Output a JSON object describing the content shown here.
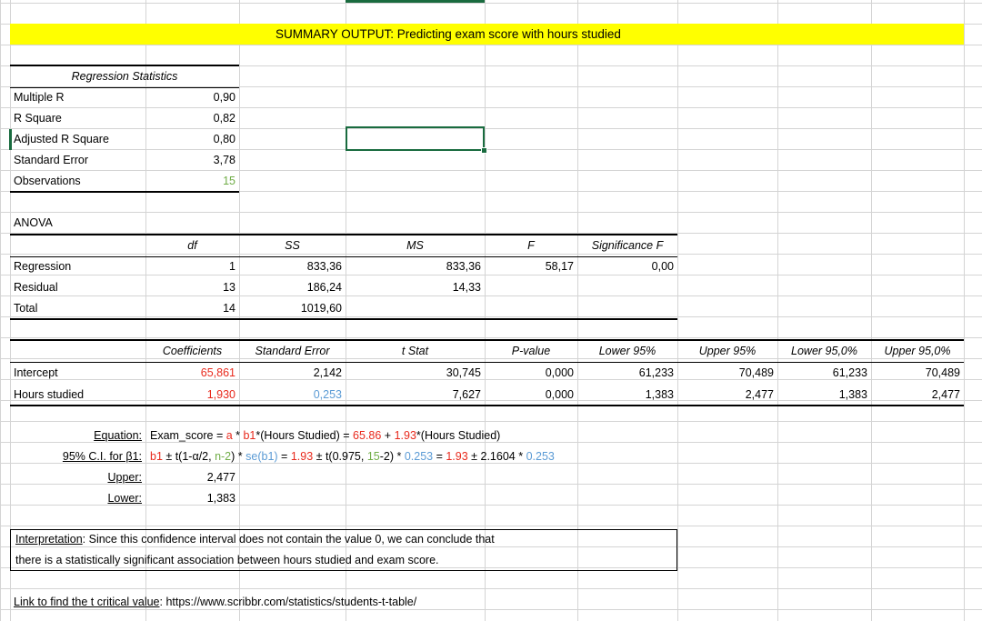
{
  "document": {
    "type": "spreadsheet",
    "title_banner": {
      "text": "SUMMARY OUTPUT: Predicting exam score with hours studied",
      "highlight_color": "#ffff00"
    }
  },
  "colors": {
    "accent_red": "#e8291c",
    "accent_green": "#70ad47",
    "accent_blue": "#5b9bd5",
    "selection_green": "#196b3f",
    "highlight_yellow": "#ffff00",
    "gridline": "#d4d4d4"
  },
  "regression_statistics": {
    "header": "Regression Statistics",
    "rows": [
      {
        "label": "Multiple R",
        "value": "0,90"
      },
      {
        "label": "R Square",
        "value": "0,82"
      },
      {
        "label": "Adjusted R Square",
        "value": "0,80"
      },
      {
        "label": "Standard Error",
        "value": "3,78"
      },
      {
        "label": "Observations",
        "value": "15"
      }
    ]
  },
  "anova": {
    "title": "ANOVA",
    "columns": [
      "",
      "df",
      "SS",
      "MS",
      "F",
      "Significance F"
    ],
    "rows": [
      {
        "label": "Regression",
        "df": "1",
        "ss": "833,36",
        "ms": "833,36",
        "f": "58,17",
        "sig_f": "0,00"
      },
      {
        "label": "Residual",
        "df": "13",
        "ss": "186,24",
        "ms": "14,33",
        "f": "",
        "sig_f": ""
      },
      {
        "label": "Total",
        "df": "14",
        "ss": "1019,60",
        "ms": "",
        "f": "",
        "sig_f": ""
      }
    ]
  },
  "coefficients": {
    "columns": [
      "",
      "Coefficients",
      "Standard Error",
      "t Stat",
      "P-value",
      "Lower 95%",
      "Upper 95%",
      "Lower 95,0%",
      "Upper 95,0%"
    ],
    "rows": [
      {
        "label": "Intercept",
        "coefficient": "65,861",
        "standard_error": "2,142",
        "t_stat": "30,745",
        "p_value": "0,000",
        "lower_95": "61,233",
        "upper_95": "70,489",
        "lower_95_0": "61,233",
        "upper_95_0": "70,489"
      },
      {
        "label": "Hours studied",
        "coefficient": "1,930",
        "standard_error": "0,253",
        "t_stat": "7,627",
        "p_value": "0,000",
        "lower_95": "1,383",
        "upper_95": "2,477",
        "lower_95_0": "1,383",
        "upper_95_0": "2,477"
      }
    ]
  },
  "equation": {
    "label": "Equation:",
    "parts": [
      {
        "text": "Exam_score = ",
        "color": "black"
      },
      {
        "text": "a",
        "color": "red"
      },
      {
        "text": " * ",
        "color": "black"
      },
      {
        "text": "b1",
        "color": "red"
      },
      {
        "text": "*(Hours Studied) = ",
        "color": "black"
      },
      {
        "text": "65.86",
        "color": "red"
      },
      {
        "text": " + ",
        "color": "black"
      },
      {
        "text": "1.93",
        "color": "red"
      },
      {
        "text": "*(Hours Studied)",
        "color": "black"
      }
    ]
  },
  "confidence_interval": {
    "label": "95% C.I. for β1:",
    "parts": [
      {
        "text": "b1",
        "color": "red"
      },
      {
        "text": " ± t(1-α/2, ",
        "color": "black"
      },
      {
        "text": "n-2",
        "color": "green"
      },
      {
        "text": ") * ",
        "color": "black"
      },
      {
        "text": "se(b1)",
        "color": "blue"
      },
      {
        "text": " = ",
        "color": "black"
      },
      {
        "text": "1.93",
        "color": "red"
      },
      {
        "text": " ± t(0.975, ",
        "color": "black"
      },
      {
        "text": "15",
        "color": "green"
      },
      {
        "text": "-2) * ",
        "color": "black"
      },
      {
        "text": "0.253",
        "color": "blue"
      },
      {
        "text": " = ",
        "color": "black"
      },
      {
        "text": "1.93",
        "color": "red"
      },
      {
        "text": " ± 2.1604 * ",
        "color": "black"
      },
      {
        "text": "0.253",
        "color": "blue"
      }
    ]
  },
  "bounds": {
    "upper_label": "Upper:",
    "upper_value": "2,477",
    "lower_label": "Lower:",
    "lower_value": "1,383"
  },
  "interpretation": {
    "label": "Interpretation",
    "line1": "Interpretation: Since this confidence interval does not contain the value 0, we can conclude that",
    "line2": "there is a statistically significant association between hours studied and exam score."
  },
  "link_note": {
    "label": "Link to find the t critical value",
    "full_text": "Link to find the t critical value: https://www.scribbr.com/statistics/students-t-table/",
    "url": "https://www.scribbr.com/statistics/students-t-table/"
  }
}
